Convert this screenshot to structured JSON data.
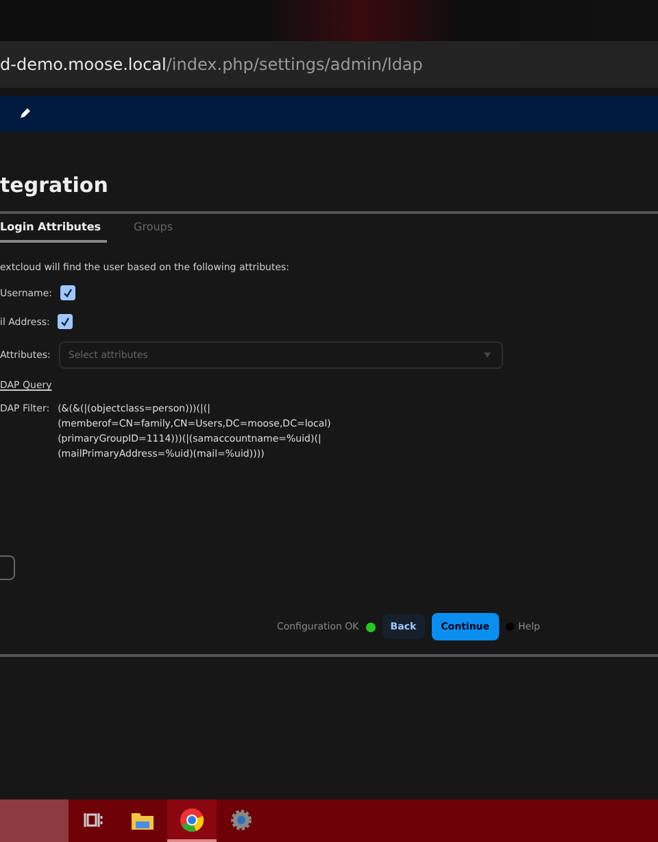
{
  "browser": {
    "url_host": "d-demo.moose.local",
    "url_path": "/index.php/settings/admin/ldap"
  },
  "page": {
    "title": "tegration"
  },
  "tabs": [
    {
      "label": "Login Attributes",
      "selected": true
    },
    {
      "label": "Groups",
      "selected": false
    }
  ],
  "intro": "extcloud will find the user based on the following attributes:",
  "fields": [
    {
      "kind": "checkbox",
      "label": "Username:",
      "checked": true
    },
    {
      "kind": "checkbox",
      "label": "il Address:",
      "checked": true
    },
    {
      "kind": "select",
      "label": "Attributes:",
      "placeholder": "Select attributes"
    }
  ],
  "query_link": "DAP Query",
  "filter": {
    "label": "DAP Filter:",
    "lines": [
      "(&(&(|(objectclass=person)))(|(|",
      "(memberof=CN=family,CN=Users,DC=moose,DC=local)",
      "(primaryGroupID=1114)))(|(samaccountname=%uid)(|",
      "(mailPrimaryAddress=%uid)(mail=%uid))))"
    ]
  },
  "footer": {
    "status": "Configuration OK",
    "status_ok": true,
    "back": "Back",
    "continue": "Continue",
    "help": "Help"
  },
  "taskbar": [
    {
      "kind": "taskview",
      "selected": false
    },
    {
      "kind": "folder",
      "selected": false
    },
    {
      "kind": "browser",
      "selected": true
    },
    {
      "kind": "settings",
      "selected": false
    }
  ]
}
